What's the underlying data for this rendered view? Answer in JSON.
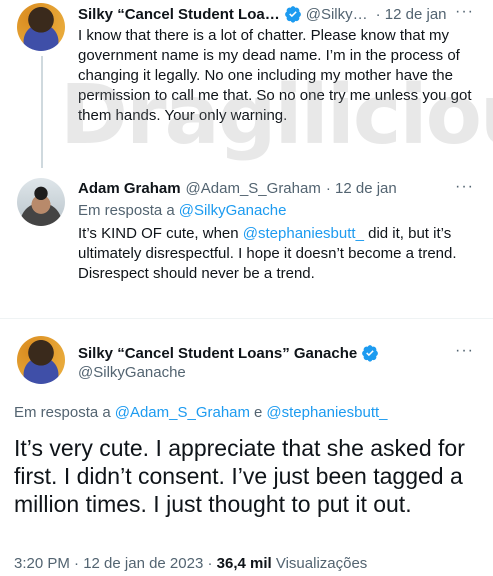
{
  "tweet1": {
    "display_name": "Silky “Cancel Student Loa…",
    "handle": "@Silky…",
    "date": "· 12 de jan",
    "body": "I know that there is a lot of chatter. Please know that my government name is my dead name. I’m in the process of changing it legally. No one including my mother have the permission to call me that. So no one try me unless you got them hands. Your only warning."
  },
  "watermark": "Dragilicious",
  "tweet2": {
    "display_name": "Adam Graham",
    "handle": "@Adam_S_Graham",
    "date": "· 12 de jan",
    "reply_prefix": "Em resposta a",
    "reply_to": "@SilkyGanache",
    "body_a": "It’s KIND OF cute, when ",
    "body_mention": "@stephaniesbutt_",
    "body_b": " did it, but it’s ultimately disrespectful. I hope it doesn’t become a trend. Disrespect should never be a trend."
  },
  "tweet3": {
    "display_name": "Silky “Cancel Student Loans” Ganache",
    "handle": "@SilkyGanache",
    "reply_prefix": "Em resposta a",
    "reply_to_1": "@Adam_S_Graham",
    "reply_and": "e",
    "reply_to_2": "@stephaniesbutt_",
    "body": "It’s very cute. I appreciate that she asked for first. I didn’t consent. I’ve just been tagged a million times. I just thought to put it out.",
    "time": "3:20 PM · 12 de jan de 2023 ·",
    "views_count": "36,4 mil",
    "views_label": "Visualizações"
  },
  "more_glyph": "···",
  "colors": {
    "accent": "#1d9bf0",
    "muted": "#536471",
    "text": "#0f1419"
  }
}
